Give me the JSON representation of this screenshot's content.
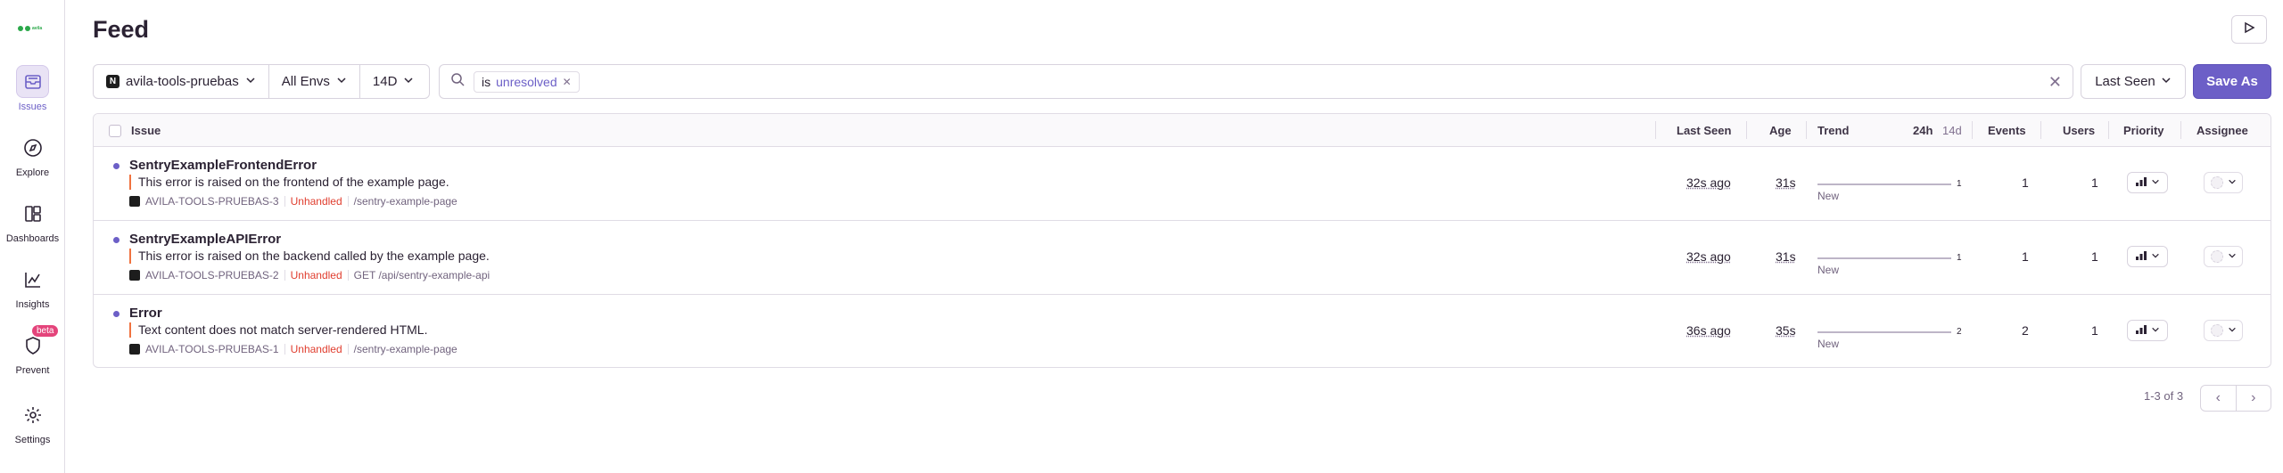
{
  "nav": {
    "items": [
      {
        "label": "Issues",
        "icon": "inbox-icon",
        "active": true
      },
      {
        "label": "Explore",
        "icon": "compass-icon"
      },
      {
        "label": "Dashboards",
        "icon": "dashboard-icon"
      },
      {
        "label": "Insights",
        "icon": "graph-icon"
      },
      {
        "label": "Prevent",
        "icon": "shield-icon",
        "badge": "beta"
      },
      {
        "label": "Settings",
        "icon": "gear-icon"
      }
    ]
  },
  "header": {
    "title": "Feed"
  },
  "filters": {
    "project": "avila-tools-pruebas",
    "env": "All Envs",
    "period": "14D",
    "search_key": "is",
    "search_value": "unresolved",
    "sort": "Last Seen",
    "save": "Save As"
  },
  "table": {
    "columns": {
      "issue": "Issue",
      "last_seen": "Last Seen",
      "age": "Age",
      "trend": "Trend",
      "period_24h": "24h",
      "period_14d": "14d",
      "events": "Events",
      "users": "Users",
      "priority": "Priority",
      "assignee": "Assignee"
    },
    "rows": [
      {
        "title": "SentryExampleFrontendError",
        "message": "This error is raised on the frontend of the example page.",
        "short_id": "AVILA-TOOLS-PRUEBAS-3",
        "handled": "Unhandled",
        "culprit": "/sentry-example-page",
        "last_seen": "32s ago",
        "age": "31s",
        "trend_count": "1",
        "trend_label": "New",
        "events": "1",
        "users": "1"
      },
      {
        "title": "SentryExampleAPIError",
        "message": "This error is raised on the backend called by the example page.",
        "short_id": "AVILA-TOOLS-PRUEBAS-2",
        "handled": "Unhandled",
        "culprit": "GET /api/sentry-example-api",
        "last_seen": "32s ago",
        "age": "31s",
        "trend_count": "1",
        "trend_label": "New",
        "events": "1",
        "users": "1"
      },
      {
        "title": "Error",
        "message": "Text content does not match server-rendered HTML.",
        "short_id": "AVILA-TOOLS-PRUEBAS-1",
        "handled": "Unhandled",
        "culprit": "/sentry-example-page",
        "last_seen": "36s ago",
        "age": "35s",
        "trend_count": "2",
        "trend_label": "New",
        "events": "2",
        "users": "1"
      }
    ]
  },
  "pagination": {
    "count": "1-3 of 3"
  },
  "colors": {
    "accent": "#6c5fc7",
    "unhandled": "#e03e2f",
    "level_bar": "#f07340"
  }
}
